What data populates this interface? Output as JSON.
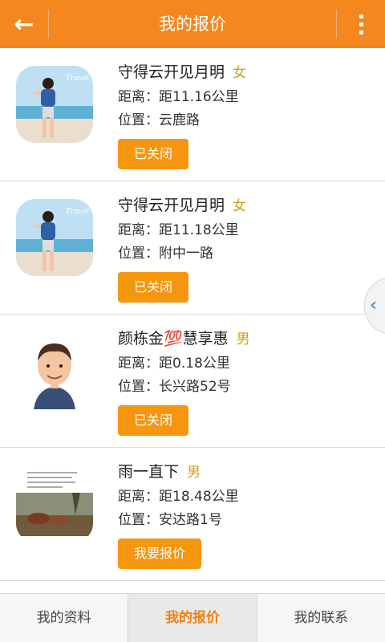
{
  "header": {
    "title": "我的报价",
    "back_icon": "arrow-left-icon",
    "more_icon": "more-vertical-icon",
    "color": "#f5871f"
  },
  "items": [
    {
      "name": "守得云开见月明",
      "gender": "女",
      "distance": "距离：距11.16公里",
      "location": "位置：云鹿路",
      "button": "已关闭",
      "avatar": "beach-photo-avatar"
    },
    {
      "name": "守得云开见月明",
      "gender": "女",
      "distance": "距离：距11.18公里",
      "location": "位置：附中一路",
      "button": "已关闭",
      "avatar": "beach-photo-avatar"
    },
    {
      "name": "颜栋金💯慧享惠",
      "gender": "男",
      "distance": "距离：距0.18公里",
      "location": "位置：长兴路52号",
      "button": "已关闭",
      "avatar": "caricature-avatar"
    },
    {
      "name": "雨一直下",
      "gender": "男",
      "distance": "距离：距18.48公里",
      "location": "位置：安达路1号",
      "button": "我要报价",
      "avatar": "landscape-text-avatar"
    }
  ],
  "tabs": [
    {
      "label": "我的资料"
    },
    {
      "label": "我的报价",
      "active": true
    },
    {
      "label": "我的联系"
    }
  ],
  "side_tab_icon": "chevron-left-icon"
}
